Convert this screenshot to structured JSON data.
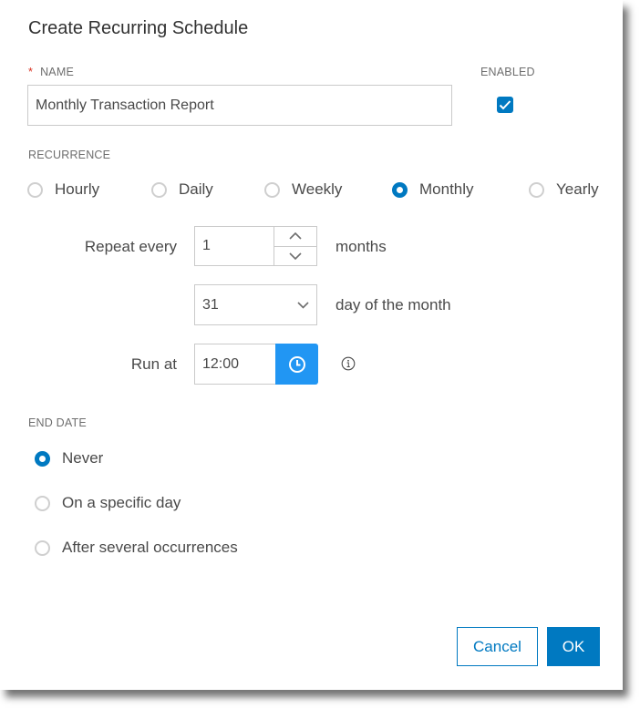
{
  "dialog": {
    "title": "Create Recurring Schedule"
  },
  "name": {
    "required_marker": "*",
    "label": "NAME",
    "value": "Monthly Transaction Report"
  },
  "enabled": {
    "label": "ENABLED",
    "checked": true
  },
  "recurrence": {
    "label": "RECURRENCE",
    "options": [
      {
        "label": "Hourly",
        "checked": false
      },
      {
        "label": "Daily",
        "checked": false
      },
      {
        "label": "Weekly",
        "checked": false
      },
      {
        "label": "Monthly",
        "checked": true
      },
      {
        "label": "Yearly",
        "checked": false
      }
    ]
  },
  "repeat": {
    "label": "Repeat every",
    "value": "1",
    "unit": "months",
    "up_icon": "chevron-up-icon",
    "down_icon": "chevron-down-icon"
  },
  "day": {
    "value": "31",
    "suffix": "day of the month",
    "icon": "chevron-down-icon"
  },
  "run_at": {
    "label": "Run at",
    "value": "12:00",
    "button_icon": "clock-icon",
    "info_icon": "info-icon"
  },
  "end_date": {
    "label": "END DATE",
    "options": [
      {
        "label": "Never",
        "checked": true
      },
      {
        "label": "On a specific day",
        "checked": false
      },
      {
        "label": "After several occurrences",
        "checked": false
      }
    ]
  },
  "footer": {
    "cancel_label": "Cancel",
    "ok_label": "OK"
  },
  "colors": {
    "accent": "#0079c1",
    "clock_button": "#2196f3",
    "required": "#d83020"
  }
}
